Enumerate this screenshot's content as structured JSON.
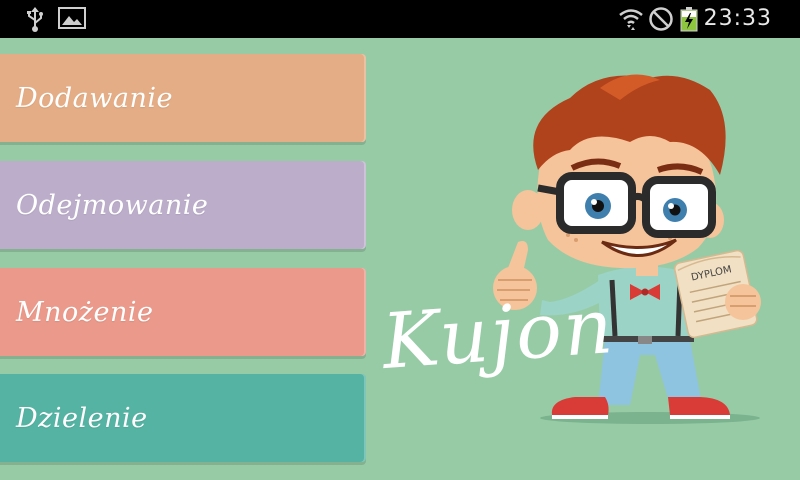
{
  "status_bar": {
    "time": "23:33",
    "icons": [
      "usb-icon",
      "image-icon",
      "wifi-icon",
      "blocked-icon",
      "battery-charging-icon"
    ]
  },
  "menu": {
    "items": [
      {
        "label": "Dodawanie",
        "color": "#e4ad85"
      },
      {
        "label": "Odejmowanie",
        "color": "#bcaecb"
      },
      {
        "label": "Mnożenie",
        "color": "#ea998a"
      },
      {
        "label": "Dzielenie",
        "color": "#55b3a3"
      }
    ]
  },
  "app": {
    "title": "Kujon",
    "background": "#97cba6"
  },
  "mascot": {
    "diploma_label": "DYPLOM"
  }
}
